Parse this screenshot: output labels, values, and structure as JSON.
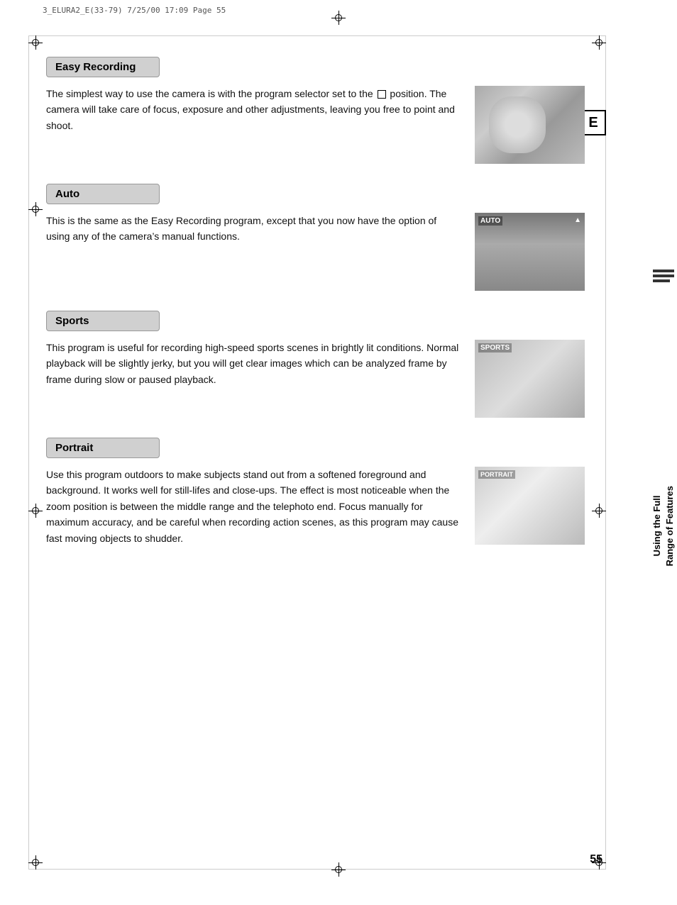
{
  "page": {
    "print_header": "3_ELURA2_E(33-79)   7/25/00 17:09   Page 55",
    "page_number": "55",
    "e_badge": "E"
  },
  "sidebar": {
    "text_line1": "Using the Full",
    "text_line2": "Range of Features"
  },
  "sections": [
    {
      "id": "easy-recording",
      "title": "Easy Recording",
      "body": "The simplest way to use the camera is with the program selector set to the □ position. The camera will take care of focus, exposure and other adjustments, leaving you free to point and shoot.",
      "image_label": "easy-recording-photo",
      "image_class": "img-easy-recording"
    },
    {
      "id": "auto",
      "title": "Auto",
      "body": "This is the same as the Easy Recording program, except that you now have the option of using any of the camera’s manual functions.",
      "image_label": "auto-photo",
      "image_class": "img-auto"
    },
    {
      "id": "sports",
      "title": "Sports",
      "body": "This program is useful for recording high-speed sports scenes in brightly lit conditions. Normal playback will be slightly jerky, but you will get clear images which can be analyzed frame by frame during slow or paused playback.",
      "image_label": "sports-photo",
      "image_class": "img-sports"
    },
    {
      "id": "portrait",
      "title": "Portrait",
      "body": "Use this program outdoors to make subjects stand out from a softened foreground and background. It works well for still-lifes and close-ups. The effect is most noticeable when the zoom position is between the middle range and the telephoto end. Focus manually for maximum accuracy, and be careful when recording action scenes, as this program may cause fast moving objects to shudder.",
      "image_label": "portrait-photo",
      "image_class": "img-portrait"
    }
  ]
}
